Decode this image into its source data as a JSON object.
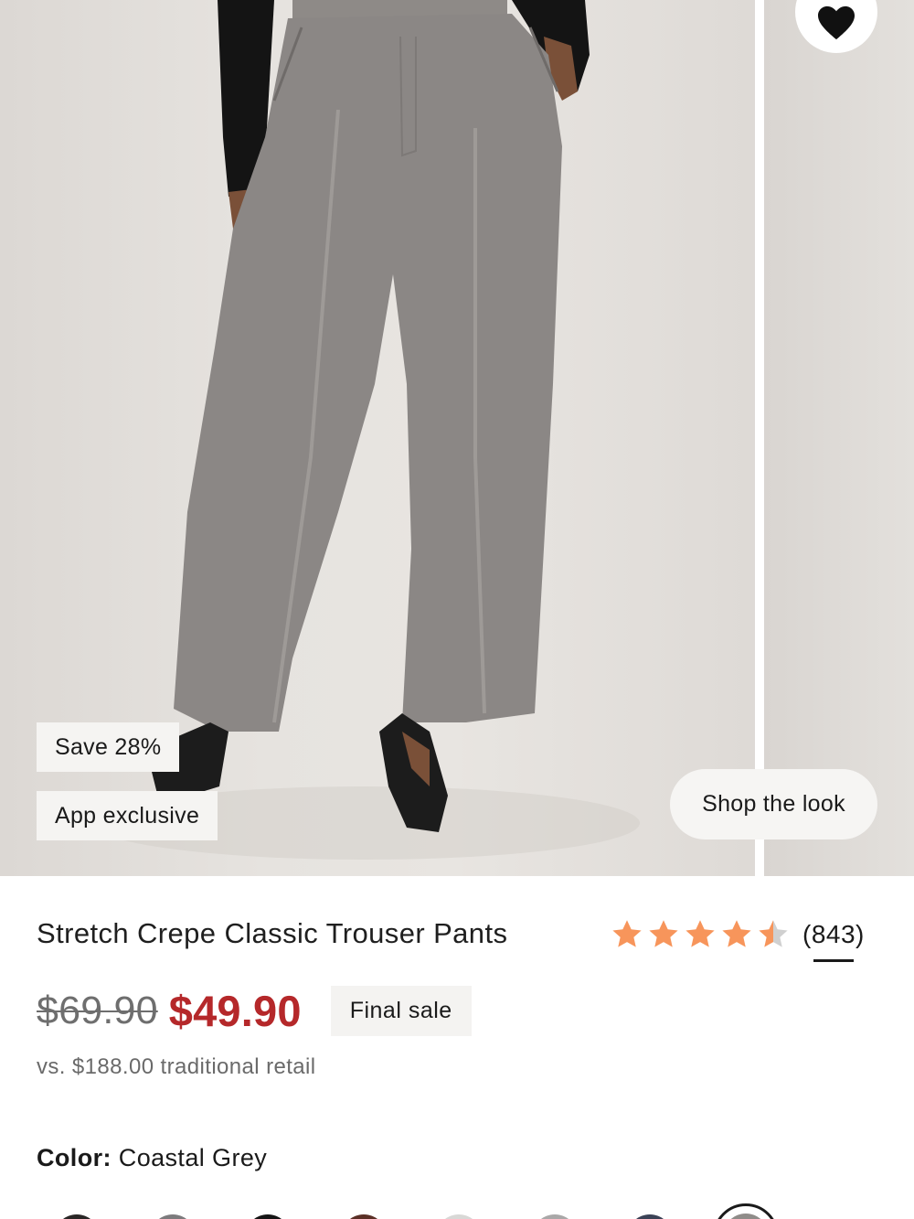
{
  "product": {
    "title": "Stretch Crepe Classic Trouser Pants",
    "rating": 4.5,
    "review_count": "(843)",
    "price_original": "$69.90",
    "price_sale": "$49.90",
    "final_sale_label": "Final sale",
    "retail_comparison": "vs. $188.00 traditional retail",
    "color_label": "Color:",
    "color_value": "Coastal Grey"
  },
  "gallery": {
    "badges": {
      "save": "Save 28%",
      "app": "App exclusive"
    },
    "shop_the_look": "Shop the look",
    "favorite_icon": "heart-icon"
  },
  "swatches": [
    {
      "color": "#2a2726"
    },
    {
      "color": "#7c7b7d"
    },
    {
      "color": "#151515"
    },
    {
      "color": "#5b3026"
    },
    {
      "color": "#d8d8d6"
    },
    {
      "color": "#a9a8a8"
    },
    {
      "color": "#3b4256"
    },
    {
      "color": "#8f8c89",
      "selected": true
    }
  ],
  "colors": {
    "sale_price": "#b5282a",
    "star": "#f7955b",
    "star_empty": "#d0d0d0"
  }
}
